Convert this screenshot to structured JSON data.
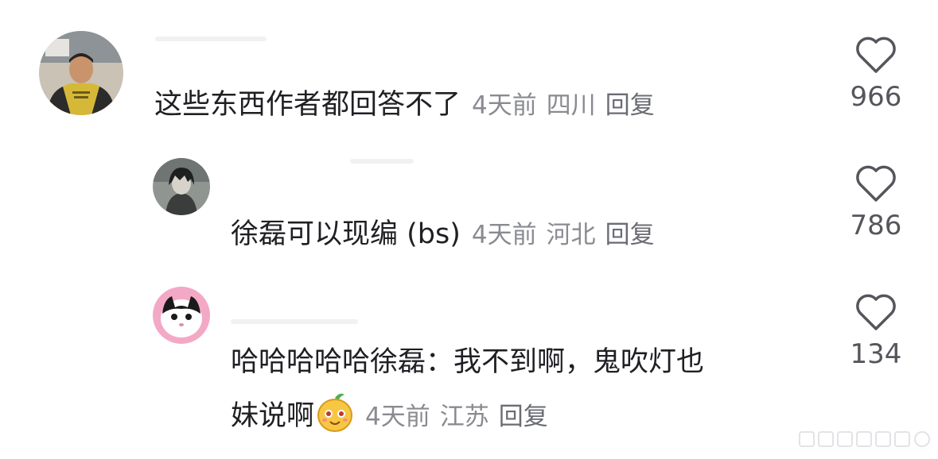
{
  "comments": [
    {
      "text": "这些东西作者都回答不了",
      "time": "4天前",
      "location": "四川",
      "reply_label": "回复",
      "likes": "966",
      "avatar": "man-in-yellow-shirt-avatar"
    },
    {
      "text": "徐磊可以现编 (bs)",
      "time": "4天前",
      "location": "河北",
      "reply_label": "回复",
      "likes": "786",
      "avatar": "anime-character-avatar"
    },
    {
      "text_line1": "哈哈哈哈哈徐磊：我不到啊，鬼吹灯也",
      "text_line2": "妹说啊",
      "emoji": "fruit-face-emoji",
      "time": "4天前",
      "location": "江苏",
      "reply_label": "回复",
      "likes": "134",
      "avatar": "black-white-cat-avatar"
    }
  ],
  "icons": {
    "like": "heart-outline-icon"
  },
  "colors": {
    "meta": "#8a8b91",
    "text": "#1f1f24",
    "heart": "#55565c"
  }
}
